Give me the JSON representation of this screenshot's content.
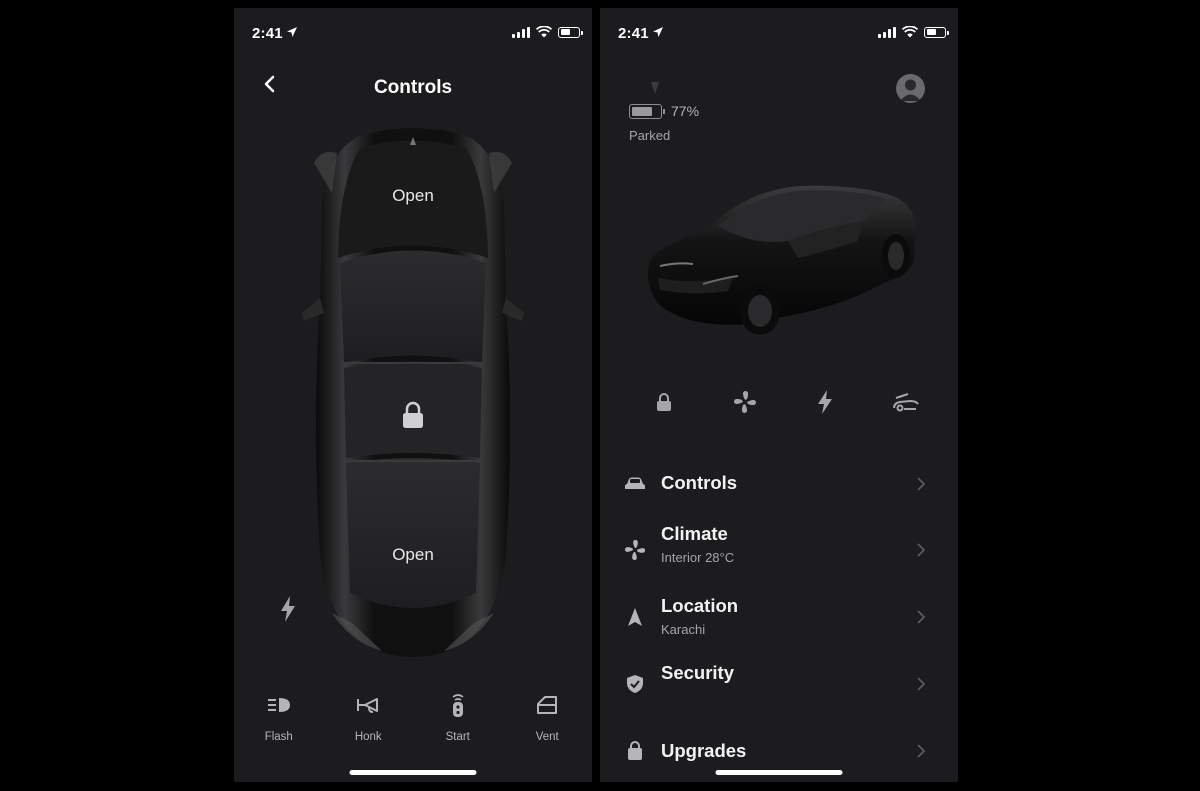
{
  "left_screen": {
    "status": {
      "time": "2:41"
    },
    "title": "Controls",
    "frunk_label": "Open",
    "trunk_label": "Open",
    "actions": [
      {
        "label": "Flash",
        "icon": "headlight-icon"
      },
      {
        "label": "Honk",
        "icon": "horn-icon"
      },
      {
        "label": "Start",
        "icon": "key-fob-icon"
      },
      {
        "label": "Vent",
        "icon": "window-vent-icon"
      }
    ]
  },
  "right_screen": {
    "status": {
      "time": "2:41"
    },
    "battery_percent": "77%",
    "battery_level": 0.77,
    "car_state": "Parked",
    "quick_actions": [
      "lock-icon",
      "fan-icon",
      "lightning-icon",
      "frunk-icon"
    ],
    "menu": [
      {
        "title": "Controls",
        "subtitle": "",
        "icon": "car-icon"
      },
      {
        "title": "Climate",
        "subtitle": "Interior 28°C",
        "icon": "fan-icon"
      },
      {
        "title": "Location",
        "subtitle": "Karachi",
        "icon": "navigation-arrow-icon"
      },
      {
        "title": "Security",
        "subtitle": "",
        "icon": "shield-check-icon"
      },
      {
        "title": "Upgrades",
        "subtitle": "",
        "icon": "shopping-bag-icon"
      }
    ]
  },
  "colors": {
    "background": "#000000",
    "panel": "#1c1c1e",
    "text": "#ffffff",
    "secondary_text": "#a6a6a8",
    "icon_gray": "#b5b5b8"
  }
}
